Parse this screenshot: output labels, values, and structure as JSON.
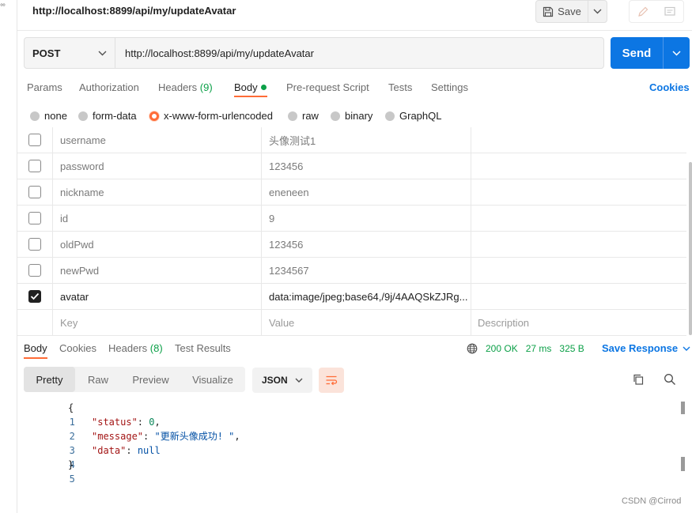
{
  "left_strip": {
    "glyph": "°°"
  },
  "top_bar": {
    "request_url": "http://localhost:8899/api/my/updateAvatar",
    "save_label": "Save"
  },
  "request": {
    "method": "POST",
    "url": "http://localhost:8899/api/my/updateAvatar",
    "send_label": "Send"
  },
  "request_tabs": {
    "params": "Params",
    "authorization": "Authorization",
    "headers": "Headers",
    "headers_count": "(9)",
    "body": "Body",
    "pre_request": "Pre-request Script",
    "tests": "Tests",
    "settings": "Settings",
    "cookies": "Cookies"
  },
  "body_types": {
    "none": "none",
    "form_data": "form-data",
    "urlencoded": "x-www-form-urlencoded",
    "raw": "raw",
    "binary": "binary",
    "graphql": "GraphQL",
    "selected": "x-www-form-urlencoded"
  },
  "params": {
    "rows": [
      {
        "key": "username",
        "value": "头像测试1",
        "description": "",
        "checked": false
      },
      {
        "key": "password",
        "value": "123456",
        "description": "",
        "checked": false
      },
      {
        "key": "nickname",
        "value": "eneneen",
        "description": "",
        "checked": false
      },
      {
        "key": "id",
        "value": "9",
        "description": "",
        "checked": false
      },
      {
        "key": "oldPwd",
        "value": "123456",
        "description": "",
        "checked": false
      },
      {
        "key": "newPwd",
        "value": "1234567",
        "description": "",
        "checked": false
      },
      {
        "key": "avatar",
        "value": "data:image/jpeg;base64,/9j/4AAQSkZJRg...",
        "description": "",
        "checked": true
      }
    ],
    "header": {
      "key": "Key",
      "value": "Value",
      "description": "Description"
    }
  },
  "response_tabs": {
    "body": "Body",
    "cookies": "Cookies",
    "headers": "Headers",
    "headers_count": "(8)",
    "test_results": "Test Results"
  },
  "response_status": {
    "status": "200 OK",
    "time": "27 ms",
    "size": "325 B",
    "save_response": "Save Response"
  },
  "response_view": {
    "pretty": "Pretty",
    "raw": "Raw",
    "preview": "Preview",
    "visualize": "Visualize",
    "format": "JSON"
  },
  "response_body": {
    "lines": [
      {
        "n": "1",
        "text": "{"
      },
      {
        "n": "2",
        "key": "\"status\"",
        "value": "0",
        "suffix": ","
      },
      {
        "n": "3",
        "key": "\"message\"",
        "value": "\"更新头像成功! \"",
        "suffix": ","
      },
      {
        "n": "4",
        "key": "\"data\"",
        "value": "null",
        "suffix": ""
      },
      {
        "n": "5",
        "text": "}"
      }
    ]
  },
  "watermark": "CSDN @Cirrod",
  "colors": {
    "accent": "#ff6c37",
    "primary": "#0c76e3",
    "success": "#0ca048"
  }
}
